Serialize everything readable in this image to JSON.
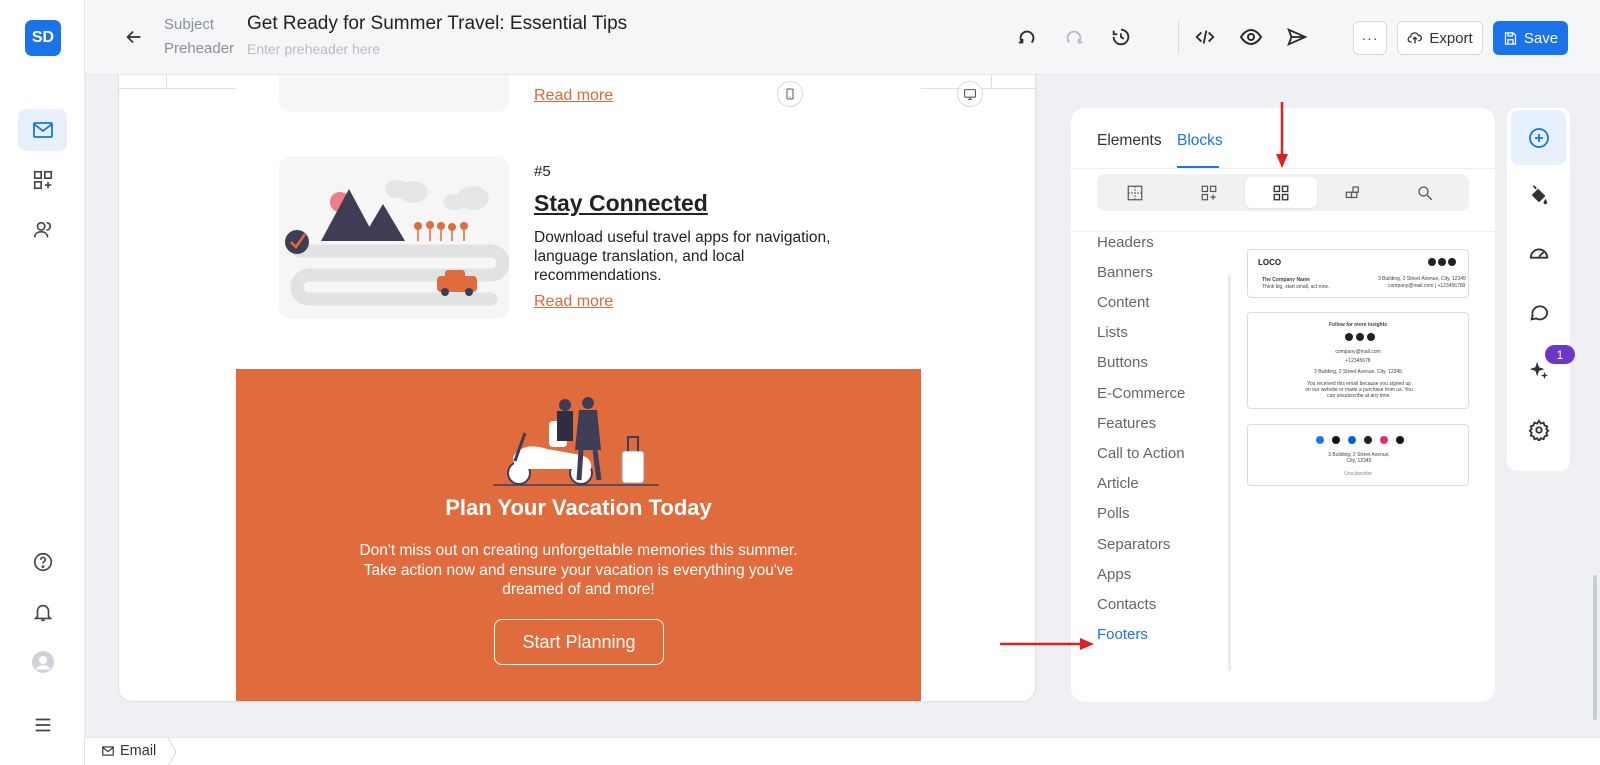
{
  "app": {
    "logo_text": "SD"
  },
  "nav": {
    "items": [
      "mail-icon",
      "blocks-icon",
      "contacts-icon"
    ],
    "bottom_items": [
      "help-icon",
      "bell-icon",
      "avatar",
      "menu-icon"
    ]
  },
  "header": {
    "subject_label": "Subject",
    "subject_value": "Get Ready for Summer Travel: Essential Tips",
    "preheader_label": "Preheader",
    "preheader_placeholder": "Enter preheader here",
    "more_label": "···",
    "export_label": "Export",
    "save_label": "Save"
  },
  "email": {
    "read_more_top": "Read more",
    "article": {
      "number": "#5",
      "title": "Stay Connected",
      "text": "Download useful travel apps for navigation, language translation, and local recommendations.",
      "read_more": "Read more"
    },
    "cta": {
      "title": "Plan Your Vacation Today",
      "text": "Don't miss out on creating unforgettable memories this summer. Take action now and ensure your vacation is everything you've dreamed of and more!",
      "button": "Start Planning"
    }
  },
  "panel": {
    "tabs": [
      "Elements",
      "Blocks"
    ],
    "active_tab": "Blocks",
    "categories": [
      "Headers",
      "Banners",
      "Content",
      "Lists",
      "Buttons",
      "E-Commerce",
      "Features",
      "Call to Action",
      "Article",
      "Polls",
      "Separators",
      "Apps",
      "Contacts",
      "Footers"
    ],
    "active_category": "Footers",
    "footer_previews": {
      "one": {
        "logo": "LOCO",
        "company": "The Company Name",
        "tagline": "Think big, start small, act now.",
        "address": "3 Building, 2 Street Avenue, City, 12345",
        "contact": "company@mail.com | +123456789"
      },
      "two": {
        "heading": "Follow for more insights",
        "email": "company@mail.com",
        "phone": "+12345678",
        "address": "3 Building, 2 Street Avenue, City, 12345",
        "note": "You received this email because you signed up on our website or made a purchase from us. You can unsubscribe at any time."
      },
      "three": {
        "address": "3 Building, 2 Street Avenue, City, 12345",
        "unsubscribe": "Unsubscribe"
      }
    }
  },
  "tools": {
    "badge": "1"
  },
  "footer": {
    "breadcrumb": "Email"
  },
  "colors": {
    "accent": "#1a73e8",
    "cta": "#e06c3e",
    "badge": "#6a38c8"
  }
}
